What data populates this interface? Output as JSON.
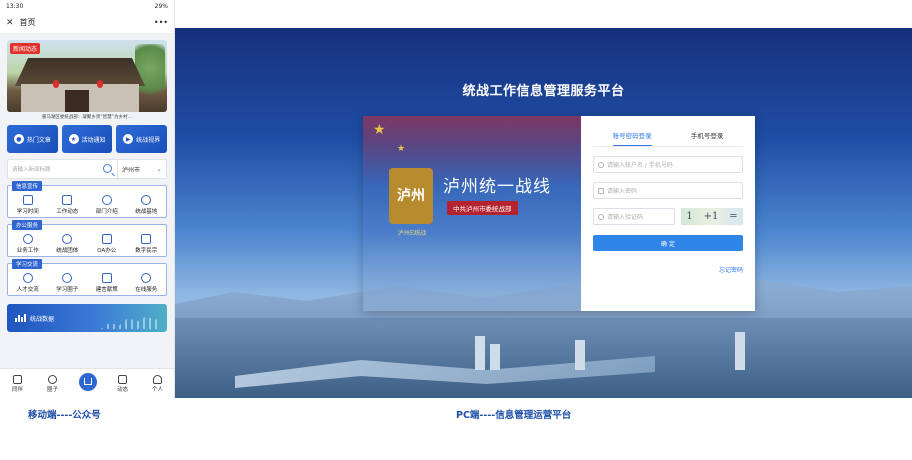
{
  "mobile": {
    "status_bar": {
      "time": "13:30",
      "battery": "29%"
    },
    "nav": {
      "title": "首页",
      "more": "•••"
    },
    "banner": {
      "tag": "新闻动态",
      "caption": "嘉马湖区委统战部：凝聚乡贤“智慧”为乡村…"
    },
    "quick_actions": [
      {
        "label": "热门文章",
        "icon": "flame-icon"
      },
      {
        "label": "活动通知",
        "icon": "star-icon"
      },
      {
        "label": "统战视界",
        "icon": "play-icon"
      }
    ],
    "search": {
      "placeholder": "请输入新闻标题",
      "city": "泸州市"
    },
    "sections": [
      {
        "tag": "信息宣传",
        "items": [
          "学习时间",
          "工作动态",
          "部门介绍",
          "统战基地"
        ]
      },
      {
        "tag": "办公服务",
        "items": [
          "业务工作",
          "统战团体",
          "OA办公",
          "数字民宗"
        ]
      },
      {
        "tag": "学习交流",
        "items": [
          "人才交流",
          "学习圈子",
          "建言献策",
          "在线服务"
        ]
      }
    ],
    "data_card": {
      "label": "统战数据"
    },
    "tabbar": [
      "同伴",
      "圈子",
      "",
      "动态",
      "个人"
    ]
  },
  "pc": {
    "title": "统战工作信息管理服务平台",
    "brand": {
      "seal_text": "泸州",
      "seal_caption": "泸州E统战",
      "name": "泸州统一战线",
      "subtitle": "中共泸州市委统战部"
    },
    "login": {
      "tabs": [
        "账号密码登录",
        "手机号登录"
      ],
      "account_placeholder": "请输入帐户名 / 手机号码",
      "password_placeholder": "请输入密码",
      "captcha_placeholder": "请输入验证码",
      "captcha_text": [
        "1",
        "+1",
        "="
      ],
      "submit": "确 定",
      "forgot": "忘记密码"
    }
  },
  "captions": {
    "mobile": "移动端----公众号",
    "pc": "PC端----信息管理运营平台"
  }
}
